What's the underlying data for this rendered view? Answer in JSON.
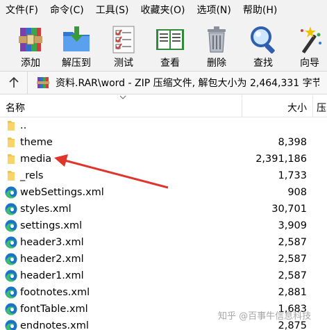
{
  "menu": [
    {
      "label": "文件(F)"
    },
    {
      "label": "命令(C)"
    },
    {
      "label": "工具(S)"
    },
    {
      "label": "收藏夹(O)"
    },
    {
      "label": "选项(N)"
    },
    {
      "label": "帮助(H)"
    }
  ],
  "toolbar": {
    "add": {
      "label": "添加",
      "icon": "add-archive-icon"
    },
    "extract": {
      "label": "解压到",
      "icon": "extract-folder-icon"
    },
    "test": {
      "label": "测试",
      "icon": "test-checklist-icon"
    },
    "view": {
      "label": "查看",
      "icon": "view-book-icon"
    },
    "delete": {
      "label": "删除",
      "icon": "trash-icon"
    },
    "find": {
      "label": "查找",
      "icon": "magnifier-icon"
    },
    "wizard": {
      "label": "向导",
      "icon": "wizard-wand-icon"
    }
  },
  "path": {
    "text": "资料.RAR\\word - ZIP 压缩文件, 解包大小为 2,464,331 字节"
  },
  "columns": {
    "name": "名称",
    "size": "大小",
    "next": "压"
  },
  "files": [
    {
      "name": "..",
      "size": "",
      "icon": "folder-icon"
    },
    {
      "name": "theme",
      "size": "8,398",
      "icon": "folder-icon"
    },
    {
      "name": "media",
      "size": "2,391,186",
      "icon": "folder-icon"
    },
    {
      "name": "_rels",
      "size": "1,733",
      "icon": "folder-icon"
    },
    {
      "name": "webSettings.xml",
      "size": "908",
      "icon": "edge-xml-icon"
    },
    {
      "name": "styles.xml",
      "size": "30,701",
      "icon": "edge-xml-icon"
    },
    {
      "name": "settings.xml",
      "size": "3,909",
      "icon": "edge-xml-icon"
    },
    {
      "name": "header3.xml",
      "size": "2,587",
      "icon": "edge-xml-icon"
    },
    {
      "name": "header2.xml",
      "size": "2,587",
      "icon": "edge-xml-icon"
    },
    {
      "name": "header1.xml",
      "size": "2,587",
      "icon": "edge-xml-icon"
    },
    {
      "name": "footnotes.xml",
      "size": "2,881",
      "icon": "edge-xml-icon"
    },
    {
      "name": "fontTable.xml",
      "size": "1,683",
      "icon": "edge-xml-icon"
    },
    {
      "name": "endnotes.xml",
      "size": "2,875",
      "icon": "edge-xml-icon"
    }
  ],
  "watermark": "知乎 @百事牛信息科技",
  "colors": {
    "annotation_arrow": "#e0352b",
    "folder": "#f5c542",
    "edge_blue": "#1a73c8",
    "edge_green": "#3bbf6b"
  }
}
